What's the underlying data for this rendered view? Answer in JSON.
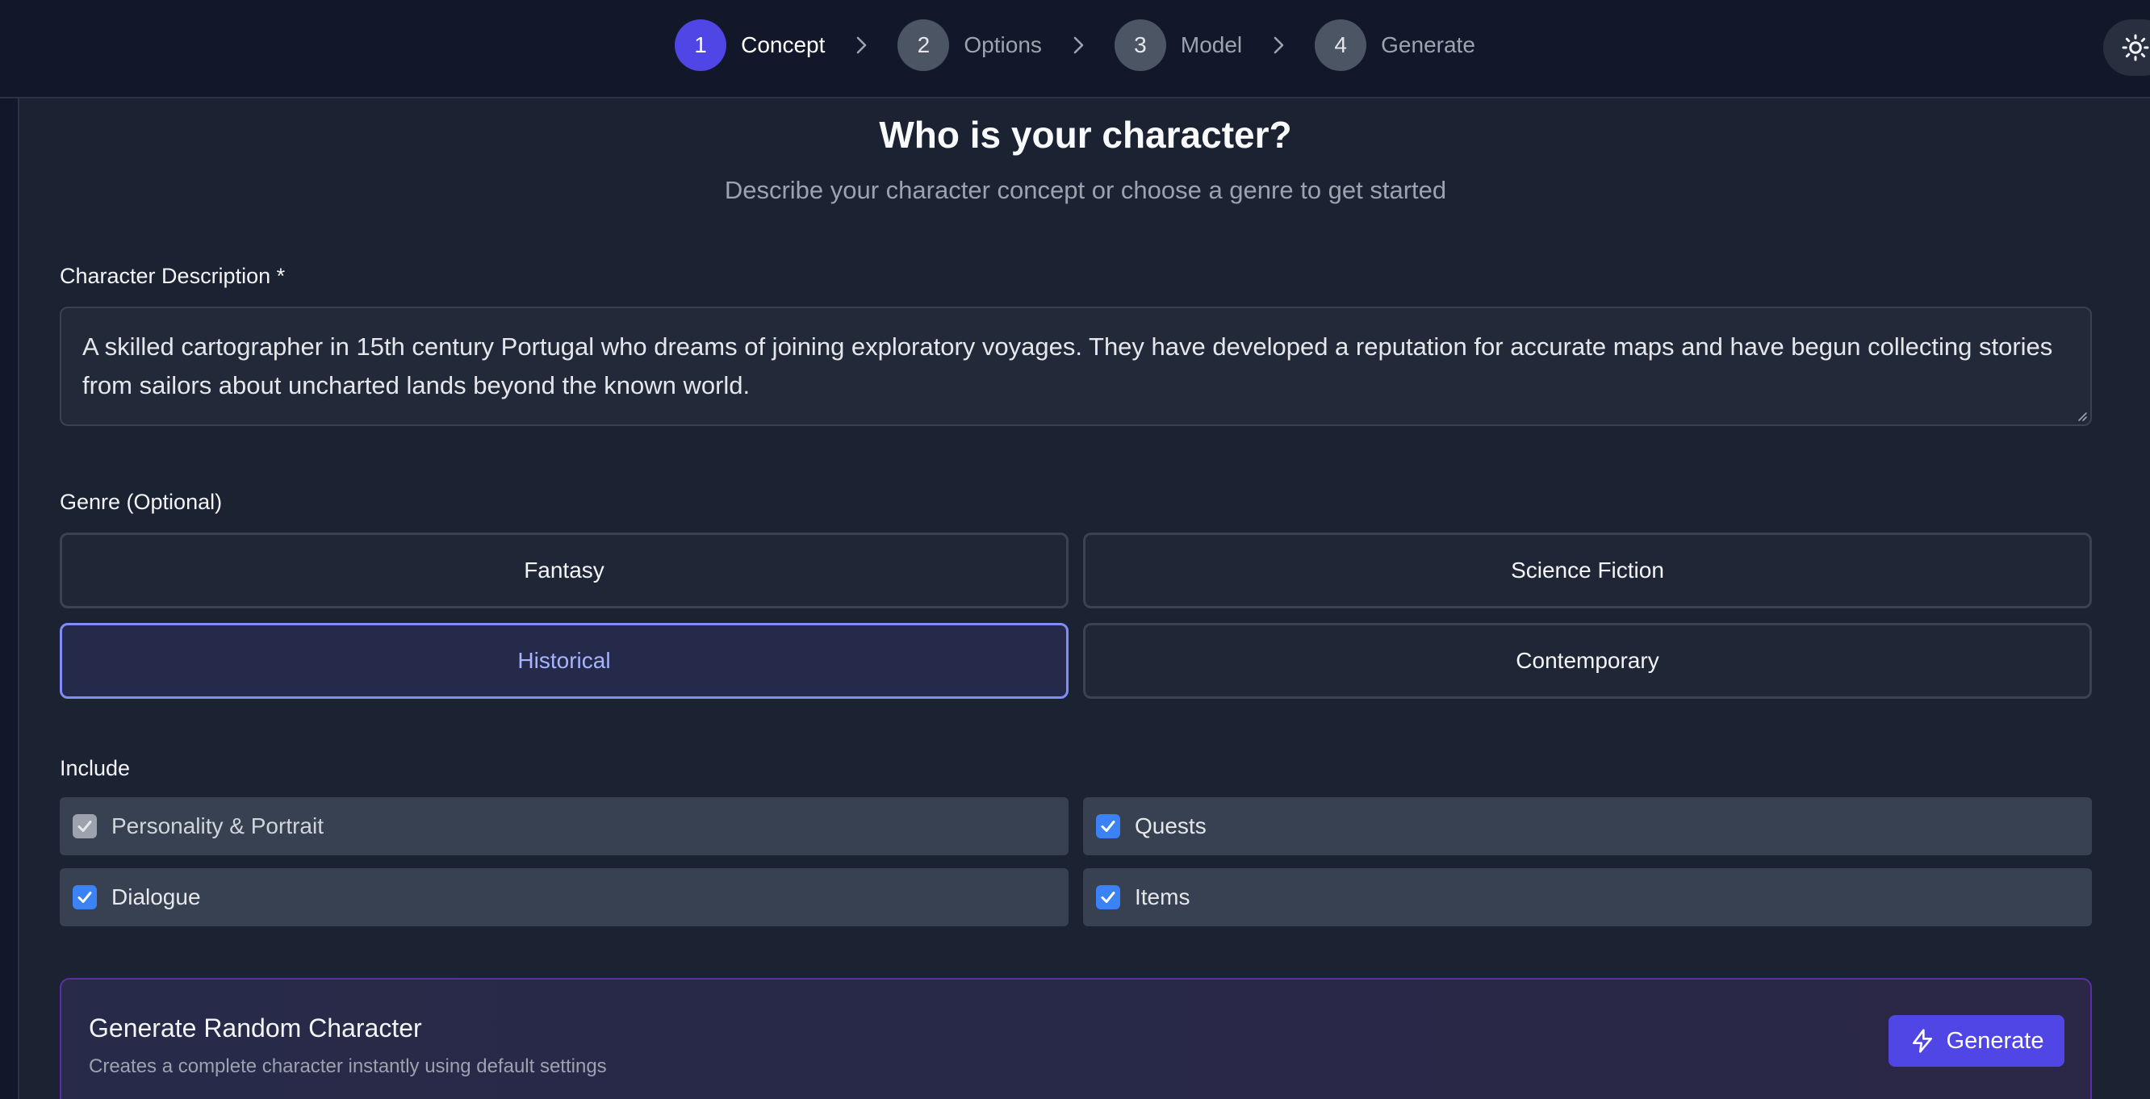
{
  "stepper": {
    "steps": [
      {
        "num": "1",
        "label": "Concept",
        "active": true
      },
      {
        "num": "2",
        "label": "Options",
        "active": false
      },
      {
        "num": "3",
        "label": "Model",
        "active": false
      },
      {
        "num": "4",
        "label": "Generate",
        "active": false
      }
    ]
  },
  "theme_toggle": {
    "icon": "sun-icon"
  },
  "concept": {
    "title": "Who is your character?",
    "subtitle": "Describe your character concept or choose a genre to get started",
    "description_label": "Character Description *",
    "description_value": "A skilled cartographer in 15th century Portugal who dreams of joining exploratory voyages. They have developed a reputation for accurate maps and have begun collecting stories from sailors about uncharted lands beyond the known world.",
    "genre_label": "Genre (Optional)",
    "genres": [
      {
        "label": "Fantasy",
        "selected": false
      },
      {
        "label": "Science Fiction",
        "selected": false
      },
      {
        "label": "Historical",
        "selected": true
      },
      {
        "label": "Contemporary",
        "selected": false
      }
    ],
    "include_label": "Include",
    "include": [
      {
        "label": "Personality & Portrait",
        "checked": true,
        "disabled": true
      },
      {
        "label": "Quests",
        "checked": true,
        "disabled": false
      },
      {
        "label": "Dialogue",
        "checked": true,
        "disabled": false
      },
      {
        "label": "Items",
        "checked": true,
        "disabled": false
      }
    ]
  },
  "random": {
    "title": "Generate Random Character",
    "description": "Creates a complete character instantly using default settings",
    "button_label": "Generate",
    "button_icon": "lightning-icon"
  },
  "colors": {
    "accent": "#4f46e5",
    "selected_border": "#818cf8",
    "checkbox": "#3b82f6"
  }
}
